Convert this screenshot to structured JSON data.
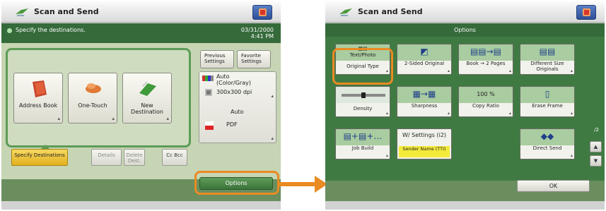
{
  "left_screen": {
    "title": "Scan and Send",
    "status_message": "Specify the destinations.",
    "date": "03/31/2000",
    "time": "4:41 PM",
    "destination_buttons": [
      {
        "label": "Address Book",
        "icon": "address-book-icon"
      },
      {
        "label": "One-Touch",
        "icon": "one-touch-icon"
      },
      {
        "label": "New Destination",
        "icon": "new-destination-icon"
      }
    ],
    "tabs": [
      {
        "label": "Specify Destinations",
        "state": "active"
      },
      {
        "label": "Details",
        "state": "disabled"
      },
      {
        "label": "Delete Dest.",
        "state": "disabled"
      },
      {
        "label": "Cc Bcc",
        "state": "normal"
      }
    ],
    "previous_settings": "Previous Settings",
    "favorite_settings": "Favorite Settings",
    "settings": {
      "color_mode": "Auto (Color/Gray)",
      "resolution": "300x300 dpi",
      "size": "Auto",
      "file_format": "PDF"
    },
    "options_button": "Options"
  },
  "right_screen": {
    "title": "Scan and Send",
    "header": "Options",
    "options": [
      {
        "label": "Text/Photo",
        "sub": "Original Type",
        "icon": "original-type-icon"
      },
      {
        "label": "2-Sided Original",
        "icon": "two-sided-original-icon"
      },
      {
        "label": "Book → 2 Pages",
        "icon": "book-to-pages-icon"
      },
      {
        "label": "Different Size Originals",
        "icon": "different-size-icon"
      },
      {
        "label": "Density",
        "icon": "density-slider-icon"
      },
      {
        "label": "Sharpness",
        "icon": "sharpness-icon"
      },
      {
        "label": "Copy Ratio",
        "value": "100 %"
      },
      {
        "label": "Erase Frame",
        "icon": "erase-frame-icon"
      },
      {
        "label": "Job Build",
        "icon": "job-build-icon"
      },
      {
        "label": "W/ Settings (i2)",
        "badge": "Sender Name (TTI)"
      },
      {
        "label": "Direct Send",
        "icon": "direct-send-icon"
      }
    ],
    "page_indicator": "/2",
    "ok_button": "OK"
  },
  "colors": {
    "accent_highlight": "#ea8a22",
    "status_green": "#356a3a",
    "active_tab": "#f0c840"
  }
}
